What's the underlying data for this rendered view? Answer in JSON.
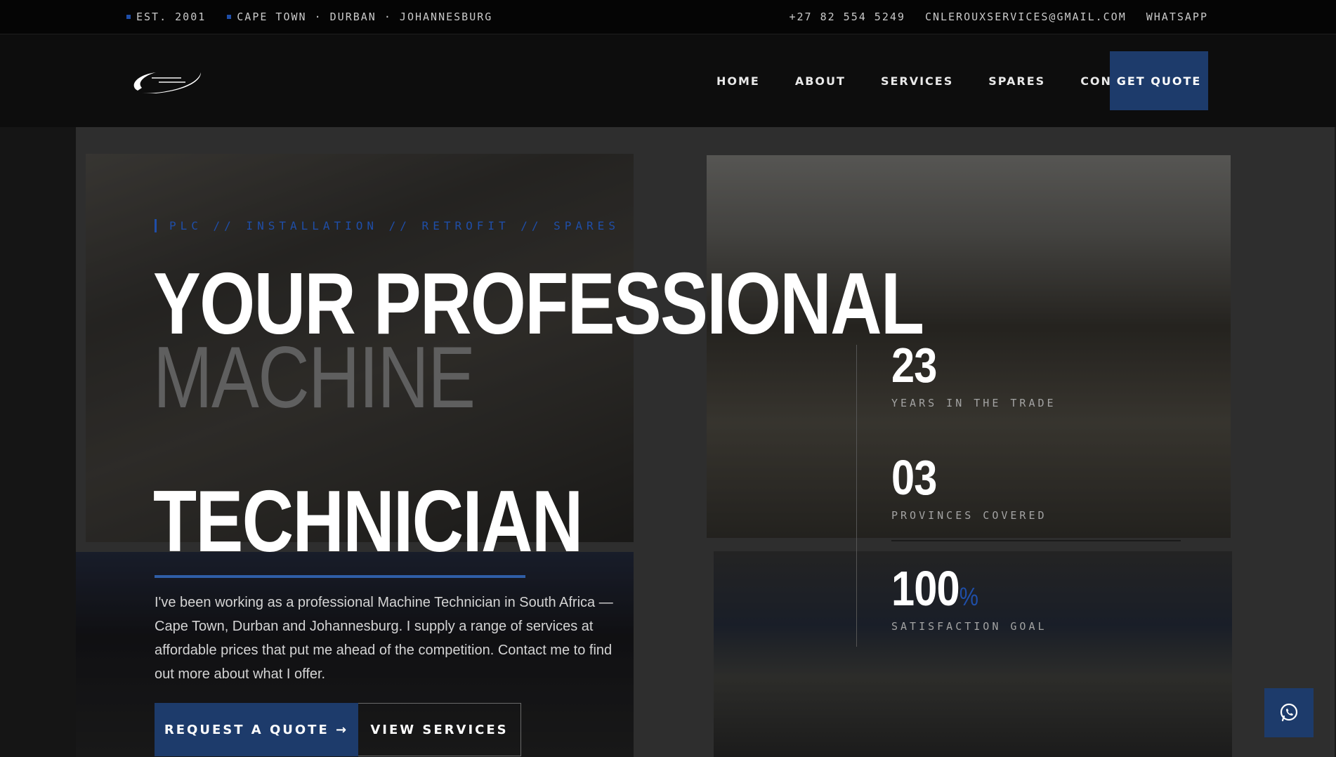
{
  "topbar": {
    "est": "EST. 2001",
    "locations": "CAPE TOWN · DURBAN · JOHANNESBURG",
    "phone": "+27 82 554 5249",
    "email": "CNLEROUXSERVICES@GMAIL.COM",
    "whatsapp": "WHATSAPP"
  },
  "nav": {
    "items": [
      "HOME",
      "ABOUT",
      "SERVICES",
      "SPARES",
      "CONTACT"
    ],
    "cta": "GET QUOTE"
  },
  "hero": {
    "eyebrow": "PLC // INSTALLATION // RETROFIT // SPARES",
    "title_line1": "YOUR PROFESSIONAL",
    "title_line2": "MACHINE",
    "title_line3": "TECHNICIAN",
    "lead": "I've been working as a professional Machine Technician in South Africa — Cape Town, Durban and Johannesburg. I supply a range of services at affordable prices that put me ahead of the competition. Contact me to find out more about what I offer.",
    "primary_button": "REQUEST A QUOTE →",
    "secondary_button": "VIEW SERVICES"
  },
  "stats": [
    {
      "value": "23",
      "suffix": "",
      "label": "YEARS IN THE TRADE"
    },
    {
      "value": "03",
      "suffix": "",
      "label": "PROVINCES COVERED"
    },
    {
      "value": "100",
      "suffix": "%",
      "label": "SATISFACTION GOAL"
    }
  ],
  "colors": {
    "accent": "#1d3b6b",
    "accent_bright": "#1f4ea8",
    "background": "#0a0a0a"
  },
  "icons": {
    "whatsapp_float": "whatsapp-icon",
    "logo": "swoosh-logo"
  }
}
